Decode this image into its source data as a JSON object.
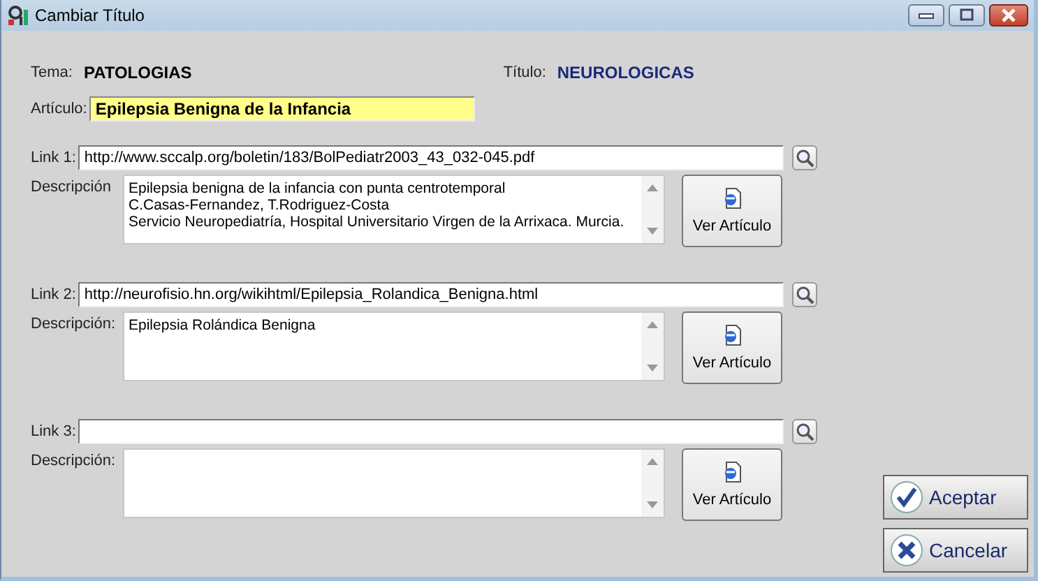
{
  "window": {
    "title": "Cambiar Título"
  },
  "tema": {
    "label": "Tema:",
    "value": "PATOLOGIAS"
  },
  "titulo": {
    "label": "Título:",
    "value": "NEUROLOGICAS"
  },
  "articulo": {
    "label": "Artículo:",
    "value": "Epilepsia Benigna de la Infancia"
  },
  "links": [
    {
      "label": "Link 1:",
      "url": "http://www.sccalp.org/boletin/183/BolPediatr2003_43_032-045.pdf",
      "desc_label": "Descripción",
      "desc_lines": [
        "Epilepsia benigna de la infancia con punta centrotemporal",
        "C.Casas-Fernandez, T.Rodriguez-Costa",
        "Servicio Neuropediatría, Hospital Universitario Virgen de la Arrixaca. Murcia."
      ],
      "button": "Ver Artículo"
    },
    {
      "label": "Link 2:",
      "url": "http://neurofisio.hn.org/wikihtml/Epilepsia_Rolandica_Benigna.html",
      "desc_label": "Descripción:",
      "desc_lines": [
        "Epilepsia Rolándica Benigna"
      ],
      "button": "Ver Artículo"
    },
    {
      "label": "Link 3:",
      "desc_label": "Descripción:",
      "button": "Ver Artículo"
    }
  ],
  "buttons": [
    {
      "kind": "accept",
      "label": "Aceptar"
    },
    {
      "kind": "cancel",
      "label": "Cancelar"
    }
  ]
}
